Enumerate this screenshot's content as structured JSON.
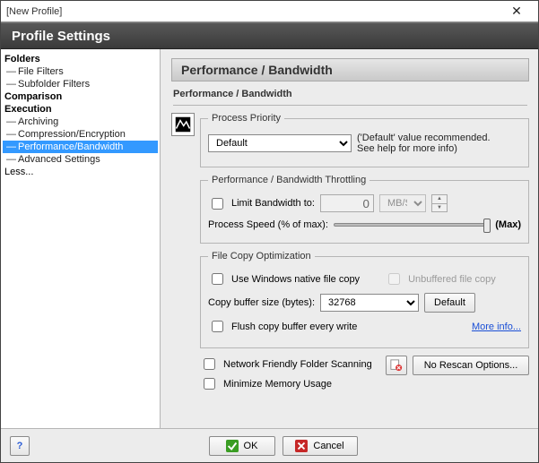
{
  "window": {
    "title": "[New Profile]",
    "close_icon": "close"
  },
  "header": {
    "title": "Profile Settings"
  },
  "sidebar": {
    "groups": [
      {
        "label": "Folders",
        "items": [
          {
            "label": "File Filters"
          },
          {
            "label": "Subfolder Filters"
          }
        ]
      },
      {
        "label": "Comparison",
        "items": []
      },
      {
        "label": "Execution",
        "items": [
          {
            "label": "Archiving"
          },
          {
            "label": "Compression/Encryption"
          },
          {
            "label": "Performance/Bandwidth",
            "selected": true
          },
          {
            "label": "Advanced Settings"
          }
        ]
      },
      {
        "label": "Less...",
        "items": []
      }
    ]
  },
  "page": {
    "title": "Performance / Bandwidth",
    "breadcrumb": "Performance / Bandwidth",
    "priority": {
      "legend": "Process Priority",
      "value": "Default",
      "hint": "('Default' value recommended. See help for more info)"
    },
    "throttling": {
      "legend": "Performance / Bandwidth Throttling",
      "limit_label": "Limit Bandwidth to:",
      "limit_value": "0",
      "unit_value": "MB/S",
      "speed_label": "Process Speed (% of max):",
      "max_label": "(Max)"
    },
    "filecopy": {
      "legend": "File Copy Optimization",
      "native_label": "Use Windows native file copy",
      "unbuffered_label": "Unbuffered file copy",
      "buffer_label": "Copy buffer size (bytes):",
      "buffer_value": "32768",
      "default_btn": "Default",
      "flush_label": "Flush copy buffer every write",
      "moreinfo_label": "More info..."
    },
    "network_label": "Network Friendly Folder Scanning",
    "minimize_label": "Minimize Memory Usage",
    "rescan_btn": "No Rescan Options..."
  },
  "footer": {
    "help": "?",
    "ok": "OK",
    "cancel": "Cancel"
  }
}
